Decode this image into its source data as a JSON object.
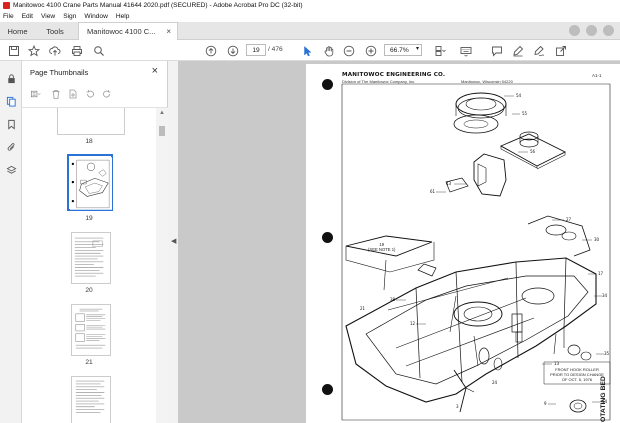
{
  "window": {
    "title": "Manitowoc 4100 Crane Parts Manual 41644 2020.pdf (SECURED) - Adobe Acrobat Pro DC (32-bit)"
  },
  "menu": [
    "File",
    "Edit",
    "View",
    "Sign",
    "Window",
    "Help"
  ],
  "tabs": {
    "home": "Home",
    "tools": "Tools",
    "document": "Manitowoc 4100 C...",
    "document_close": "×"
  },
  "toolbar": {
    "current_page": "19",
    "page_total": "/ 476",
    "zoom": "66.7%"
  },
  "thumbnails_panel": {
    "title": "Page Thumbnails",
    "close": "×",
    "pages": [
      "18",
      "19",
      "20",
      "21"
    ],
    "selected_page": "19"
  },
  "document": {
    "header": "MANITOWOC ENGINEERING CO.",
    "subheader_left": "Division of The Manitowoc Company, Inc.",
    "subheader_right": "Manitowoc, Wisconsin 54220",
    "page_ref": "A1-1",
    "note_side": "19\n(SEE NOTE 1)",
    "note_front_roller": "FRONT HOOK ROLLER\nPRIOR TO DESIGN CHANGE\nOF OCT. 5, 1976",
    "side_title": "OTATING BED"
  },
  "icons": {
    "home_toolbar": [
      "star-icon",
      "upload-icon",
      "print-icon",
      "search-icon"
    ],
    "nav": [
      "page-up-icon",
      "page-down-icon",
      "pointer-icon",
      "hand-icon",
      "zoom-out-icon",
      "zoom-in-icon"
    ],
    "view": [
      "page-layout-icon",
      "keyboard-icon"
    ],
    "annotate": [
      "comment-icon",
      "highlight-icon",
      "sign-icon",
      "share-icon"
    ],
    "rail": [
      "lock-icon",
      "thumbnails-icon",
      "bookmark-icon",
      "attachment-icon",
      "layers-icon"
    ]
  },
  "colors": {
    "accent": "#2a72d6",
    "brand_red": "#d9261c",
    "canvas_bg": "#c9c9c9"
  }
}
